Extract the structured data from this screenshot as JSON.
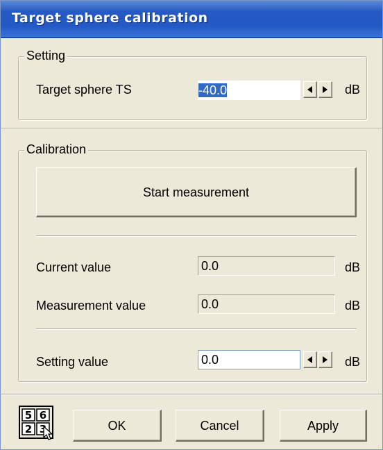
{
  "window": {
    "title": "Target sphere calibration"
  },
  "setting_group": {
    "label": "Setting",
    "target_ts_label": "Target sphere TS",
    "target_ts_value": "-40.0",
    "unit": "dB"
  },
  "calibration_group": {
    "label": "Calibration",
    "start_button": "Start measurement",
    "current_label": "Current value",
    "current_value": "0.0",
    "measurement_label": "Measurement value",
    "measurement_value": "0.0",
    "setting_label": "Setting value",
    "setting_value": "0.0",
    "unit": "dB"
  },
  "footer": {
    "numpad_keys": [
      "5",
      "6",
      "2",
      "3"
    ],
    "ok_label": "OK",
    "cancel_label": "Cancel",
    "apply_label": "Apply"
  }
}
